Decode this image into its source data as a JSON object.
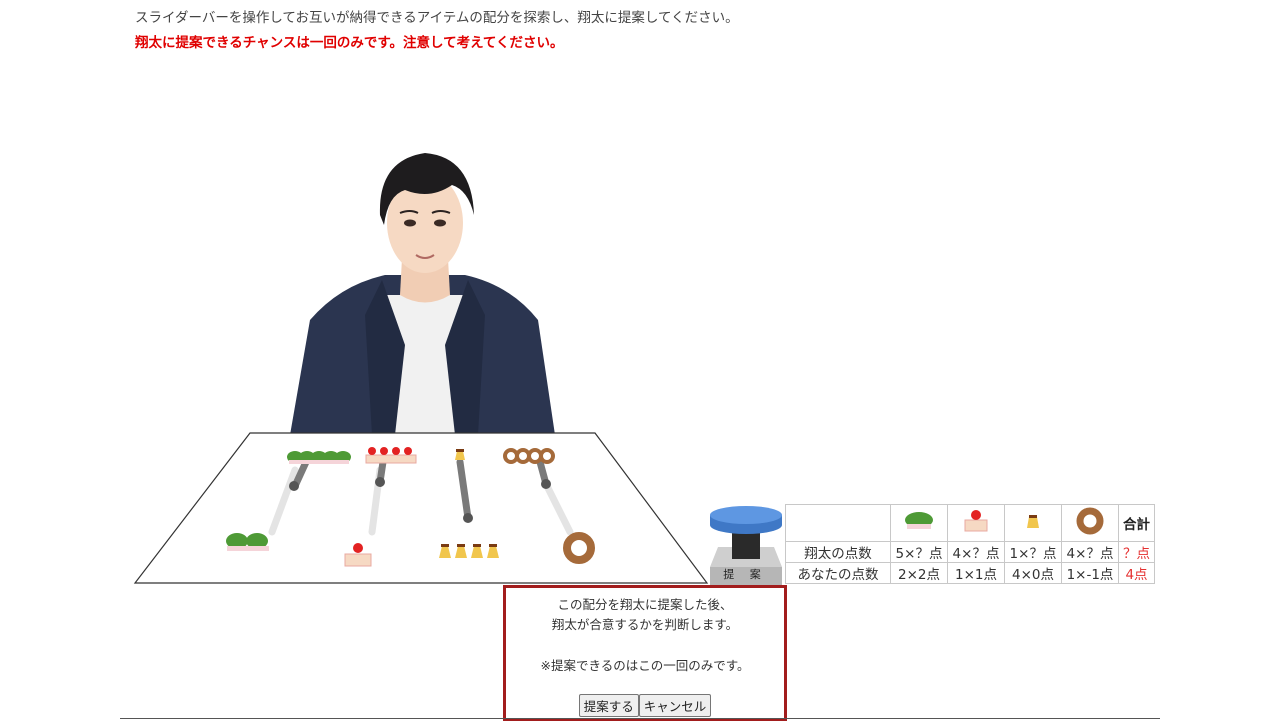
{
  "instructions": {
    "line1": "スライダーバーを操作してお互いが納得できるアイテムの配分を探索し、翔太に提案してください。",
    "line2": "翔太に提案できるチャンスは一回のみです。注意して考えてください。"
  },
  "items": [
    {
      "name": "kashiwa-mochi",
      "icon": "kashiwa-mochi-icon",
      "count": 5,
      "partner_share": 3,
      "your_share": 2
    },
    {
      "name": "strawberry-cake",
      "icon": "strawberry-cake-icon",
      "count": 4,
      "partner_share": 3,
      "your_share": 1
    },
    {
      "name": "pudding",
      "icon": "pudding-icon",
      "count": 5,
      "partner_share": 1,
      "your_share": 4
    },
    {
      "name": "donut",
      "icon": "donut-icon",
      "count": 4,
      "partner_share": 3,
      "your_share": 1
    }
  ],
  "propose_button": {
    "label": "提 案"
  },
  "score_table": {
    "total_header": "合計",
    "rows": [
      {
        "label": "翔太の点数",
        "cells": [
          "5×？点",
          "4×？点",
          "1×？点",
          "4×？点"
        ],
        "total": "？点"
      },
      {
        "label": "あなたの点数",
        "cells": [
          "2×2点",
          "1×1点",
          "4×0点",
          "1×-1点"
        ],
        "total": "4点"
      }
    ]
  },
  "dialog": {
    "line1": "この配分を翔太に提案した後、",
    "line2": "翔太が合意するかを判断します。",
    "note": "※提案できるのはこの一回のみです。",
    "confirm_label": "提案する",
    "cancel_label": "キャンセル"
  },
  "colors": {
    "warning": "#e00000",
    "dialog_border": "#a21d1d",
    "total_red": "#e53030",
    "button_blue": "#4a86d6"
  }
}
